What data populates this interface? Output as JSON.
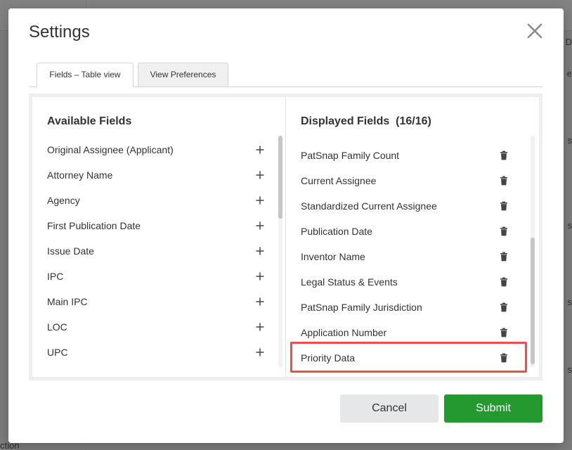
{
  "background": {
    "bottom_text": "ction",
    "right_texts": [
      "n D",
      "e",
      "s",
      "s",
      "s",
      "s"
    ]
  },
  "modal": {
    "title": "Settings",
    "close_icon": "close-icon"
  },
  "tabs": [
    {
      "label": "Fields – Table view",
      "active": true
    },
    {
      "label": "View Preferences",
      "active": false
    }
  ],
  "available": {
    "title": "Available Fields",
    "items": [
      {
        "label": "Original Assignee (Applicant)"
      },
      {
        "label": "Attorney Name"
      },
      {
        "label": "Agency"
      },
      {
        "label": "First Publication Date"
      },
      {
        "label": "Issue Date"
      },
      {
        "label": "IPC"
      },
      {
        "label": "Main IPC"
      },
      {
        "label": "LOC"
      },
      {
        "label": "UPC"
      }
    ]
  },
  "displayed": {
    "title": "Displayed Fields",
    "count": "(16/16)",
    "items": [
      {
        "label": "PatSnap Family Count"
      },
      {
        "label": "Current Assignee"
      },
      {
        "label": "Standardized Current Assignee"
      },
      {
        "label": "Publication Date"
      },
      {
        "label": "Inventor Name"
      },
      {
        "label": "Legal Status & Events"
      },
      {
        "label": "PatSnap Family Jurisdiction"
      },
      {
        "label": "Application Number"
      },
      {
        "label": "Priority Data"
      }
    ]
  },
  "buttons": {
    "cancel": "Cancel",
    "submit": "Submit"
  },
  "colors": {
    "submit": "#24992f",
    "highlight": "#e8524a",
    "cancel_bg": "#e6e7e9"
  }
}
